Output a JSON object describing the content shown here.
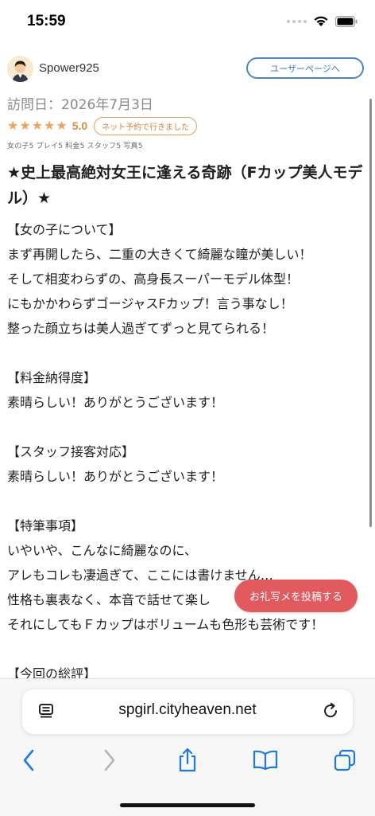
{
  "status_bar": {
    "time": "15:59",
    "battery_level": 1.0
  },
  "reviewer": {
    "name": "Spower925",
    "user_page_label": "ユーザーページへ"
  },
  "visit": {
    "date_text": "訪問日：2026年7月3日"
  },
  "rating": {
    "stars": 5,
    "value": "5.0",
    "badge": "ネット予約で行きました",
    "scores": "女の子5 プレイ5 料金5 スタッフ5 写真5",
    "star_color": "#e8a65c"
  },
  "review": {
    "title": "★史上最高絶対女王に逢える奇跡（Fカップ美人モデル）★",
    "lines": [
      "【女の子について】",
      "まず再開したら、二重の大きくて綺麗な瞳が美しい！",
      "そして相変わらずの、高身長スーパーモデル体型！",
      "にもかかわらずゴージャスFカップ！言う事なし！",
      "整った顔立ちは美人過ぎてずっと見てられる！",
      "",
      "【料金納得度】",
      "素晴らしい！ありがとうございます！",
      "",
      "【スタッフ接客対応】",
      "素晴らしい！ありがとうございます！",
      "",
      "【特筆事項】",
      "いやいや、こんなに綺麗なのに、",
      "アレもコレも凄過ぎて、ここには書けません…",
      "性格も裏表なく、本音で話せて楽し",
      "それにしてもＦカップはボリュームも色形も芸術です！",
      "",
      "【今回の総評】"
    ]
  },
  "post_photo_button": {
    "label": "お礼写メを投稿する",
    "color": "#e05a5e"
  },
  "browser": {
    "url": "spgirl.cityheaven.net",
    "toolbar": [
      "back-icon",
      "forward-icon",
      "share-icon",
      "bookmarks-icon",
      "tabs-icon"
    ],
    "accent": "#1f7ae0"
  }
}
